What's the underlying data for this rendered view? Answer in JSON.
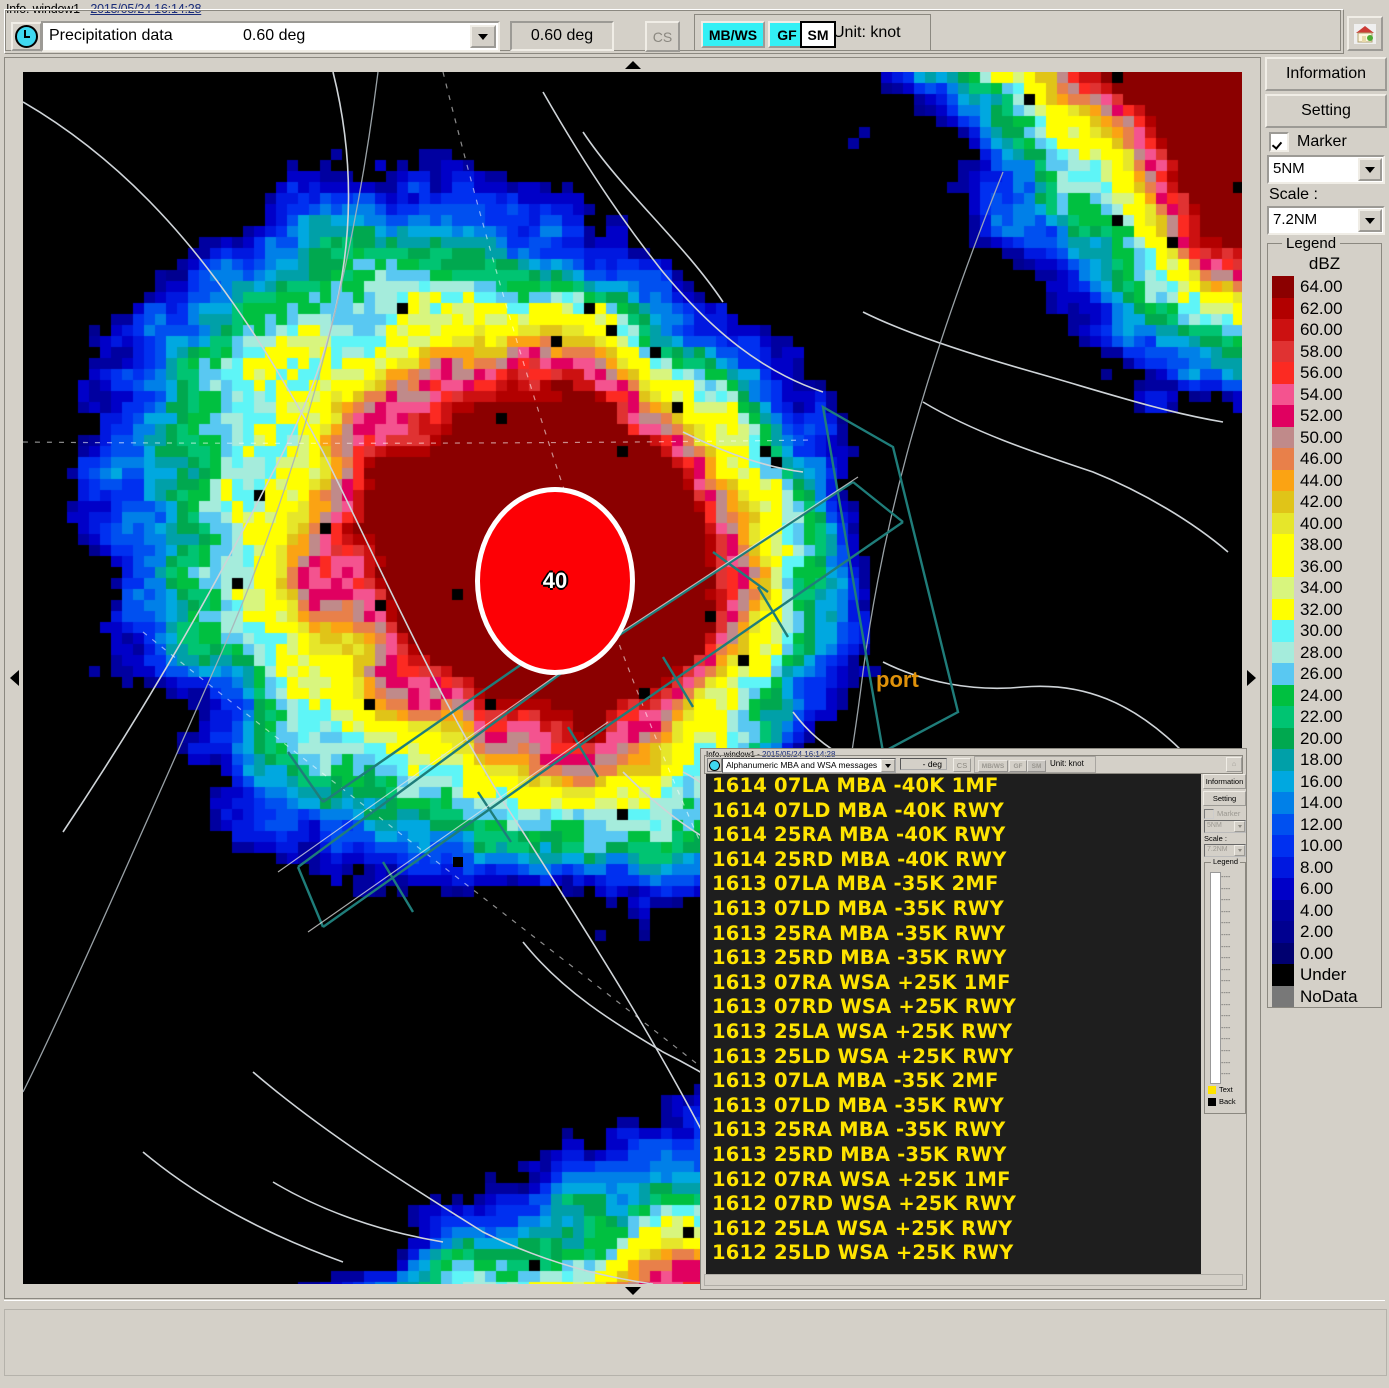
{
  "window": {
    "title_prefix": "Info. window1 - ",
    "timestamp": "2015/05/24 16:14:28",
    "clock_icon": "clock-icon",
    "home_icon": "home-icon"
  },
  "toolbar": {
    "product_select": "Precipitation data",
    "product_elevation": "0.60 deg",
    "elevation_readout": "0.60 deg",
    "cs_label": "CS",
    "mode_buttons": [
      {
        "label": "MB/WS",
        "active": true,
        "color": "#33f0f5"
      },
      {
        "label": "GF",
        "active": true,
        "color": "#33f0f5"
      },
      {
        "label": "SM",
        "active": false,
        "color": "#ffffff"
      }
    ],
    "unit_label": "Unit: knot"
  },
  "sidebar": {
    "information_button": "Information",
    "setting_button": "Setting",
    "marker_checkbox_label": "Marker",
    "marker_checked": true,
    "marker_range": "5NM",
    "scale_label": "Scale :",
    "scale_value": "7.2NM",
    "legend_title": "Legend",
    "legend_unit": "dBZ",
    "legend": [
      {
        "value": "64.00",
        "color": "#8b0000"
      },
      {
        "value": "62.00",
        "color": "#b20000"
      },
      {
        "value": "60.00",
        "color": "#cc1111"
      },
      {
        "value": "58.00",
        "color": "#e03232"
      },
      {
        "value": "56.00",
        "color": "#fc2a22"
      },
      {
        "value": "54.00",
        "color": "#f4538f"
      },
      {
        "value": "52.00",
        "color": "#e00060"
      },
      {
        "value": "50.00",
        "color": "#c08a8a"
      },
      {
        "value": "46.00",
        "color": "#e8804a"
      },
      {
        "value": "44.00",
        "color": "#fba313"
      },
      {
        "value": "42.00",
        "color": "#e0c418"
      },
      {
        "value": "40.00",
        "color": "#e6e62a"
      },
      {
        "value": "38.00",
        "color": "#ffff00"
      },
      {
        "value": "36.00",
        "color": "#ffff00"
      },
      {
        "value": "34.00",
        "color": "#d8f57e"
      },
      {
        "value": "32.00",
        "color": "#ffff00"
      },
      {
        "value": "30.00",
        "color": "#5ef5f7"
      },
      {
        "value": "28.00",
        "color": "#a5ecdc"
      },
      {
        "value": "26.00",
        "color": "#59c8f2"
      },
      {
        "value": "24.00",
        "color": "#00c040"
      },
      {
        "value": "22.00",
        "color": "#00c472"
      },
      {
        "value": "20.00",
        "color": "#00a84f"
      },
      {
        "value": "18.00",
        "color": "#00a0a8"
      },
      {
        "value": "16.00",
        "color": "#00a8e0"
      },
      {
        "value": "14.00",
        "color": "#0080e8"
      },
      {
        "value": "12.00",
        "color": "#0050f0"
      },
      {
        "value": "10.00",
        "color": "#0030f0"
      },
      {
        "value": "8.00",
        "color": "#0018e0"
      },
      {
        "value": "6.00",
        "color": "#0000c8"
      },
      {
        "value": "4.00",
        "color": "#0000a0"
      },
      {
        "value": "2.00",
        "color": "#000090"
      },
      {
        "value": "0.00",
        "color": "#000070"
      },
      {
        "value": "Under",
        "color": "#000000"
      },
      {
        "value": "NoData",
        "color": "#787878"
      }
    ]
  },
  "radar": {
    "microburst_label": "40",
    "microburst_color": "#fd0005",
    "airport_label": "port",
    "airport_label_color": "#e0920a"
  },
  "inner_window": {
    "title_prefix": "Info. window1 - ",
    "timestamp": "2015/05/24 16:14:28",
    "product_select": "Alphanumeric MBA and WSA messages",
    "elevation_readout": "- deg",
    "cs_label": "CS",
    "mode_buttons": [
      {
        "label": "MB/WS"
      },
      {
        "label": "GF"
      },
      {
        "label": "SM"
      }
    ],
    "unit_label": "Unit: knot",
    "messages": [
      "1614 07LA MBA -40K 1MF",
      "1614 07LD MBA -40K RWY",
      "1614 25RA MBA -40K RWY",
      "1614 25RD MBA -40K RWY",
      "1613 07LA MBA -35K 2MF",
      "1613 07LD MBA -35K RWY",
      "1613 25RA MBA -35K RWY",
      "1613 25RD MBA -35K RWY",
      "1613 07RA WSA +25K 1MF",
      "1613 07RD WSA +25K RWY",
      "1613 25LA WSA +25K RWY",
      "1613 25LD WSA +25K RWY",
      "1613 07LA MBA -35K 2MF",
      "1613 07LD MBA -35K RWY",
      "1613 25RA MBA -35K RWY",
      "1613 25RD MBA -35K RWY",
      "1612 07RA WSA +25K 1MF",
      "1612 07RD WSA +25K RWY",
      "1612 25LA WSA +25K RWY",
      "1612 25LD WSA +25K RWY"
    ],
    "message_text_color": "#ffe400",
    "message_back_color": "#1e1e1e",
    "sidebar": {
      "information_button": "Information",
      "setting_button": "Setting",
      "marker_checkbox_label": "Marker",
      "marker_range": "5NM",
      "scale_label": "Scale :",
      "scale_value": "7.2NM",
      "legend_title": "Legend",
      "legend_text_label": "Text",
      "legend_back_label": "Back",
      "legend_text_color": "#ffe400",
      "legend_back_color": "#000000"
    }
  }
}
